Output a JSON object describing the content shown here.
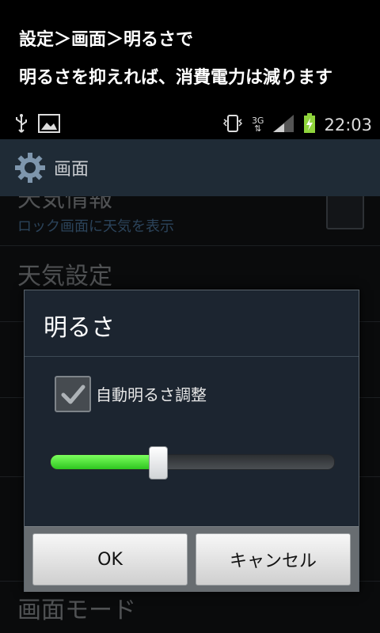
{
  "caption": {
    "line1": "設定＞画面＞明るさで",
    "line2": "明るさを抑えれば、消費電力は減ります"
  },
  "status_bar": {
    "icons_left": [
      "usb-icon",
      "image-icon"
    ],
    "icons_right": [
      "vibrate-icon",
      "network-3g-icon",
      "signal-icon",
      "battery-charging-icon"
    ],
    "network_label": "3G",
    "time": "22:03"
  },
  "title_bar": {
    "icon": "gear-icon",
    "title": "画面"
  },
  "background_list": {
    "row_weather": {
      "label": "天気情報",
      "sub": "ロック画面に天気を表示"
    },
    "row_weather_settings": {
      "label": "天気設定"
    },
    "row_screen_mode": {
      "label": "画面モード"
    }
  },
  "dialog": {
    "title": "明るさ",
    "auto_brightness_label": "自動明るさ調整",
    "auto_brightness_checked": true,
    "brightness_level": 0.35,
    "ok_label": "OK",
    "cancel_label": "キャンセル"
  },
  "colors": {
    "slider_fill": "#3fdc2a",
    "title_bar_bg": "#1f2b36",
    "dialog_bg": "#1c2530",
    "battery_green": "#8fd43c"
  }
}
